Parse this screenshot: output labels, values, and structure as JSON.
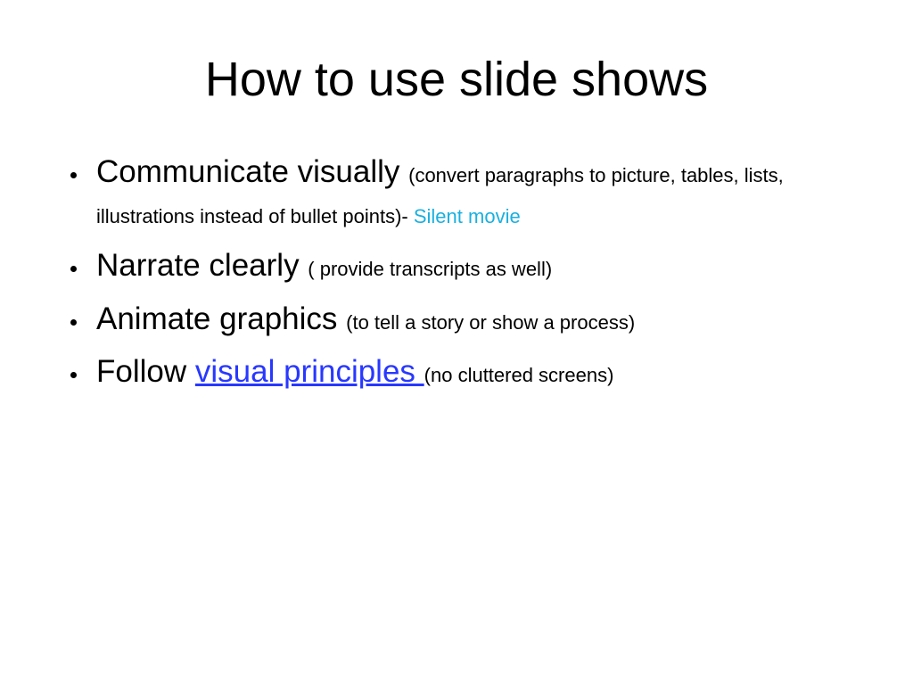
{
  "slide": {
    "title": "How to use slide shows",
    "bullets": [
      {
        "main": "Communicate visually ",
        "detail_prefix": "(convert paragraphs to picture, tables, lists, illustrations instead of bullet points)- ",
        "detail_accent": "Silent movie"
      },
      {
        "main": "Narrate clearly ",
        "detail": "( provide transcripts as well)"
      },
      {
        "main": "Animate graphics ",
        "detail": "(to tell a story or show a process)"
      },
      {
        "main_prefix": "Follow ",
        "main_link": "visual principles ",
        "detail": "(no cluttered screens)"
      }
    ]
  }
}
